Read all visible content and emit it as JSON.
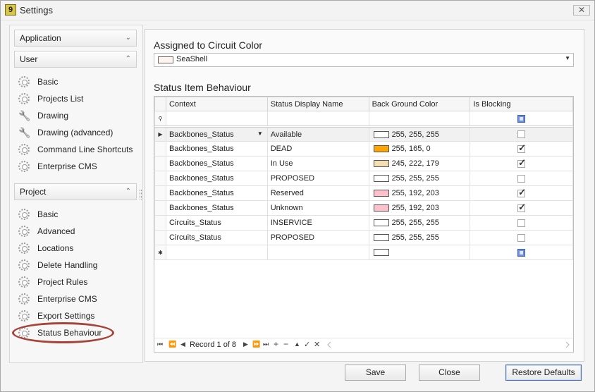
{
  "window": {
    "title": "Settings",
    "close_glyph": "✕",
    "app_icon_text": "9"
  },
  "sidebar": {
    "groups": [
      {
        "label": "Application",
        "chevron": "⌄"
      },
      {
        "label": "User",
        "chevron": "⌃"
      },
      {
        "label": "Project",
        "chevron": "⌃"
      }
    ],
    "user_items": [
      {
        "label": "Basic",
        "icon": "gear-icon"
      },
      {
        "label": "Projects List",
        "icon": "gear-icon"
      },
      {
        "label": "Drawing",
        "icon": "wrench-icon"
      },
      {
        "label": "Drawing (advanced)",
        "icon": "wrench-icon"
      },
      {
        "label": "Command Line Shortcuts",
        "icon": "gear-icon"
      },
      {
        "label": "Enterprise CMS",
        "icon": "gear-icon"
      }
    ],
    "project_items": [
      {
        "label": "Basic",
        "icon": "gear-icon"
      },
      {
        "label": "Advanced",
        "icon": "gear-icon"
      },
      {
        "label": "Locations",
        "icon": "gear-icon"
      },
      {
        "label": "Delete Handling",
        "icon": "gear-icon"
      },
      {
        "label": "Project Rules",
        "icon": "gear-icon"
      },
      {
        "label": "Enterprise CMS",
        "icon": "gear-icon"
      },
      {
        "label": "Export Settings",
        "icon": "gear-icon"
      },
      {
        "label": "Status Behaviour",
        "icon": "gear-icon"
      }
    ],
    "selected": "Status Behaviour",
    "highlight_color": "#a6443a"
  },
  "circuit_color": {
    "title": "Assigned to Circuit Color",
    "value": "SeaShell",
    "swatch": "#fff5ee"
  },
  "status_grid": {
    "title": "Status Item Behaviour",
    "columns": [
      "Context",
      "Status Display Name",
      "Back Ground Color",
      "Is Blocking"
    ],
    "rows": [
      {
        "context": "Backbones_Status",
        "name": "Available",
        "color": "255, 255, 255",
        "hex": "#ffffff",
        "blocking": false
      },
      {
        "context": "Backbones_Status",
        "name": "DEAD",
        "color": "255, 165, 0",
        "hex": "#ffa500",
        "blocking": true
      },
      {
        "context": "Backbones_Status",
        "name": "In Use",
        "color": "245, 222, 179",
        "hex": "#f5deb3",
        "blocking": true
      },
      {
        "context": "Backbones_Status",
        "name": "PROPOSED",
        "color": "255, 255, 255",
        "hex": "#ffffff",
        "blocking": false
      },
      {
        "context": "Backbones_Status",
        "name": "Reserved",
        "color": "255, 192, 203",
        "hex": "#ffc0cb",
        "blocking": true
      },
      {
        "context": "Backbones_Status",
        "name": "Unknown",
        "color": "255, 192, 203",
        "hex": "#ffc0cb",
        "blocking": true
      },
      {
        "context": "Circuits_Status",
        "name": "INSERVICE",
        "color": "255, 255, 255",
        "hex": "#ffffff",
        "blocking": false
      },
      {
        "context": "Circuits_Status",
        "name": "PROPOSED",
        "color": "255, 255, 255",
        "hex": "#ffffff",
        "blocking": false
      }
    ],
    "navigator": {
      "record_text": "Record 1 of 8"
    }
  },
  "buttons": {
    "save": "Save",
    "close": "Close",
    "restore": "Restore Defaults"
  }
}
